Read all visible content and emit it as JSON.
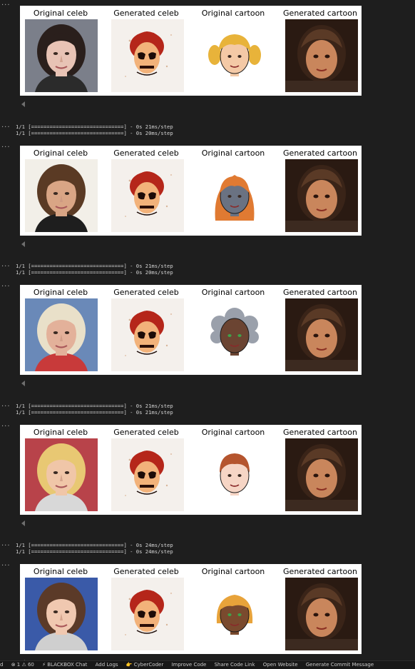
{
  "cell_prompt": "...",
  "column_titles": [
    "Original celeb",
    "Generated celeb",
    "Original cartoon",
    "Generated cartoon"
  ],
  "outputs": [
    {
      "log": [],
      "celeb": {
        "skin": "#e8c3b5",
        "hair": "#2a1f1c",
        "bg": "#7b7f8a",
        "shirt": "#2b2b2b"
      },
      "cartoon": {
        "skin": "#f4c9a6",
        "hair": "#e8b33a",
        "style": "pigtails"
      }
    },
    {
      "log": [
        "1/1 [==============================] - 0s 21ms/step",
        "1/1 [==============================] - 0s 20ms/step"
      ],
      "celeb": {
        "skin": "#d9a585",
        "hair": "#5a3a24",
        "bg": "#f2efe8",
        "shirt": "#1e1e1e"
      },
      "cartoon": {
        "skin": "#6a7282",
        "hair": "#e07a32",
        "style": "long"
      }
    },
    {
      "log": [
        "1/1 [==============================] - 0s 21ms/step",
        "1/1 [==============================] - 0s 20ms/step"
      ],
      "celeb": {
        "skin": "#e3b19a",
        "hair": "#e9e0c9",
        "bg": "#6a89b8",
        "shirt": "#c83a3a"
      },
      "cartoon": {
        "skin": "#6b4432",
        "hair": "#9aa0ab",
        "style": "curly"
      }
    },
    {
      "log": [
        "1/1 [==============================] - 0s 21ms/step",
        "1/1 [==============================] - 0s 21ms/step"
      ],
      "celeb": {
        "skin": "#f0c6a8",
        "hair": "#e8c873",
        "bg": "#b8434a",
        "shirt": "#d8d8d8"
      },
      "cartoon": {
        "skin": "#f6d5c5",
        "hair": "#b5552e",
        "style": "short"
      }
    },
    {
      "log": [
        "1/1 [==============================] - 0s 24ms/step",
        "1/1 [==============================] - 0s 24ms/step"
      ],
      "celeb": {
        "skin": "#f0c8b0",
        "hair": "#5b3a28",
        "bg": "#3a5aa8",
        "shirt": "#cfcfcf"
      },
      "cartoon": {
        "skin": "#7a4a2e",
        "hair": "#e8a33a",
        "style": "bob"
      }
    }
  ],
  "generated_palette": {
    "celeb_hair": "#b5261a",
    "celeb_skin": "#f2b27a",
    "cartoon_bg": "#2a1a12",
    "cartoon_face": "#c9865c",
    "cartoon_hair": "#3a2418"
  },
  "statusbar": {
    "items": [
      "d",
      "⊗ 1 ⚠ 60",
      "⚡ BLACKBOX Chat",
      "Add Logs",
      "👉 CyberCoder",
      "Improve Code",
      "Share Code Link",
      "Open Website",
      "Generate Commit Message"
    ]
  }
}
